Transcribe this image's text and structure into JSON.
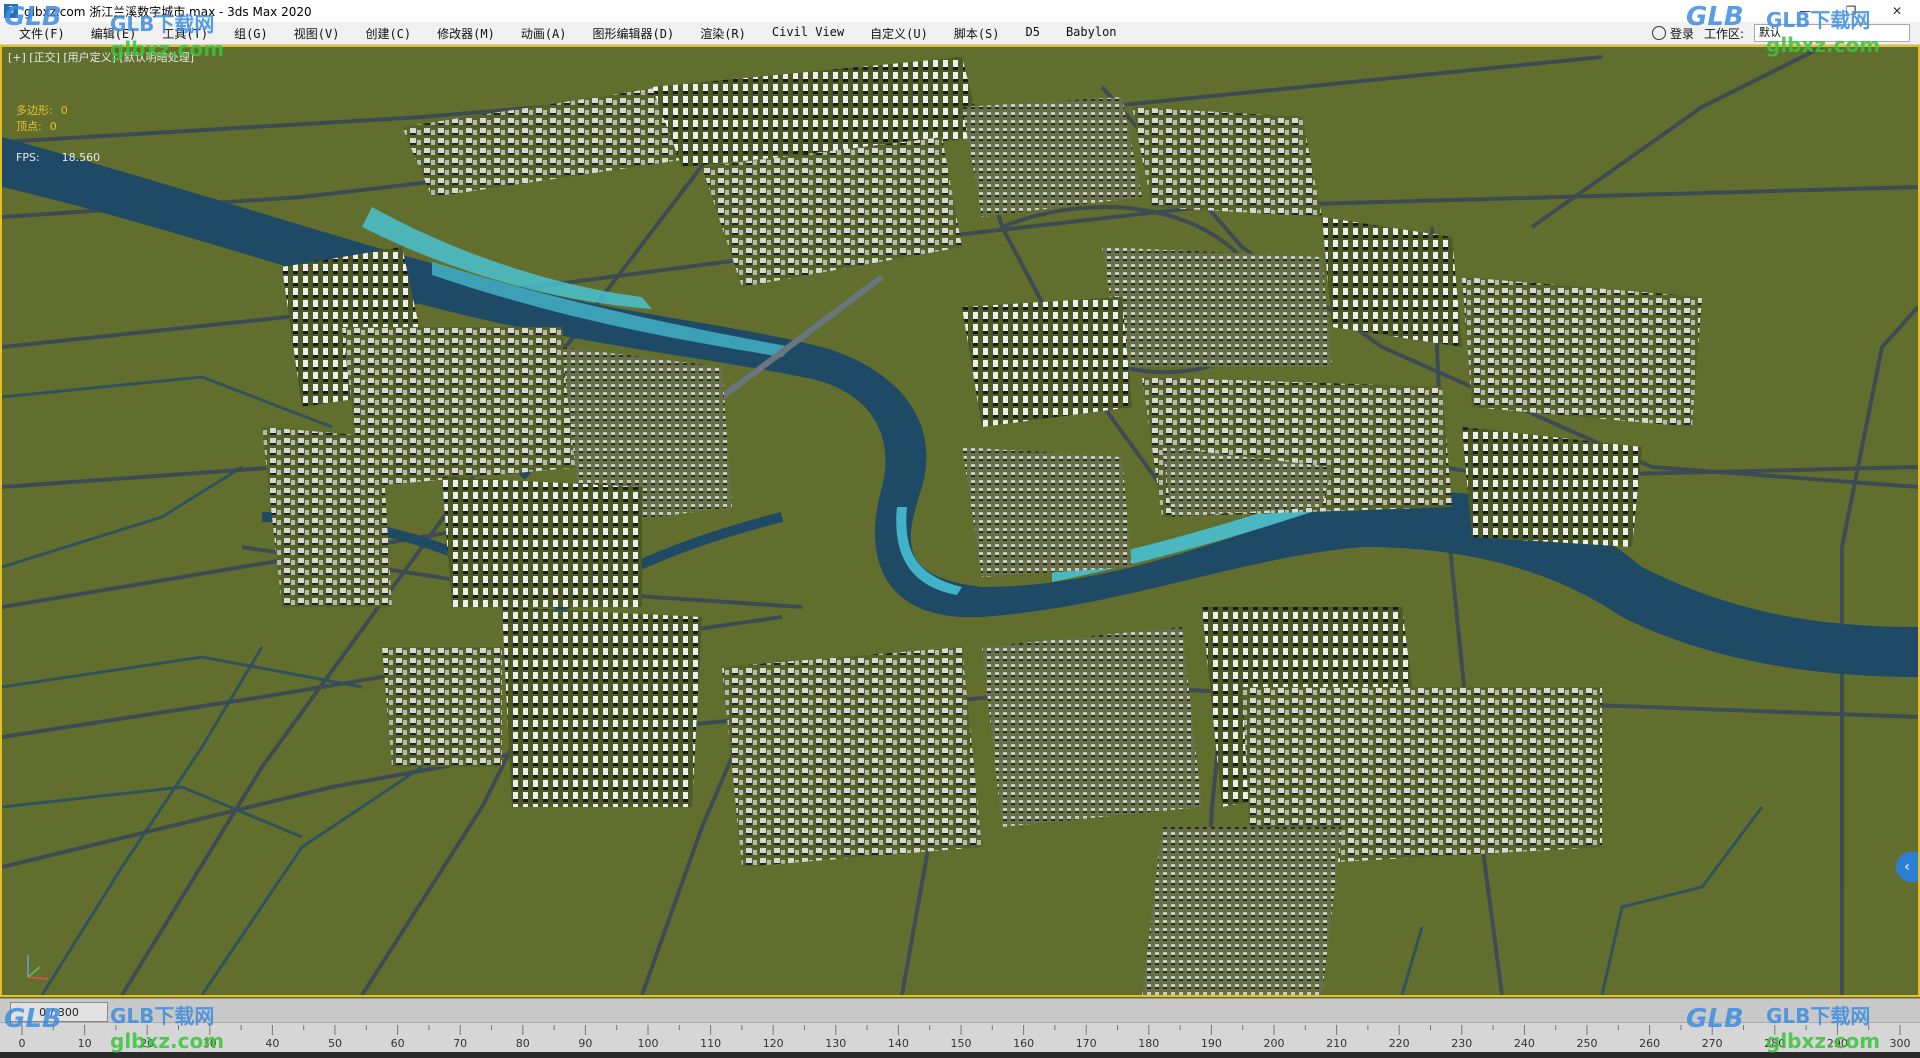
{
  "window": {
    "title": "glbxz.com 浙江兰溪数字城市.max - 3ds Max 2020",
    "controls": [
      "—",
      "❐",
      "✕"
    ]
  },
  "menu": {
    "items": [
      "文件(F)",
      "编辑(E)",
      "工具(T)",
      "组(G)",
      "视图(V)",
      "创建(C)",
      "修改器(M)",
      "动画(A)",
      "图形编辑器(D)",
      "渲染(R)",
      "Civil View",
      "自定义(U)",
      "脚本(S)",
      "D5",
      "Babylon"
    ],
    "login_label": "登录",
    "workspace_label": "工作区:",
    "workspace_value": "默认"
  },
  "viewport": {
    "label": "[+] [正交] [用户定义] [默认明暗处理]",
    "stats": {
      "polygons_label": "多边形:",
      "polygons_value": "0",
      "vertices_label": "顶点:",
      "vertices_value": "0",
      "fps_label": "FPS:",
      "fps_value": "18.560"
    },
    "side_tab_icon": "chevron-left-icon"
  },
  "timeline": {
    "current_frame": "0",
    "separator": "/",
    "total_frames": "300",
    "ticks": [
      0,
      10,
      20,
      30,
      40,
      50,
      60,
      70,
      80,
      90,
      100,
      110,
      120,
      130,
      140,
      150,
      160,
      170,
      180,
      190,
      200,
      210,
      220,
      230,
      240,
      250,
      260,
      270,
      280,
      290,
      300
    ]
  },
  "watermarks": {
    "logo": "GLB",
    "cn": "GLB下载网",
    "url": "glbxz.com"
  },
  "colors": {
    "terrain": "#5f6a2c",
    "river": "#1f4a66",
    "river_shallow": "#48c6da",
    "road": "#3e4a55",
    "viewport_border": "#e6c020",
    "accent": "#2d7fd6"
  }
}
